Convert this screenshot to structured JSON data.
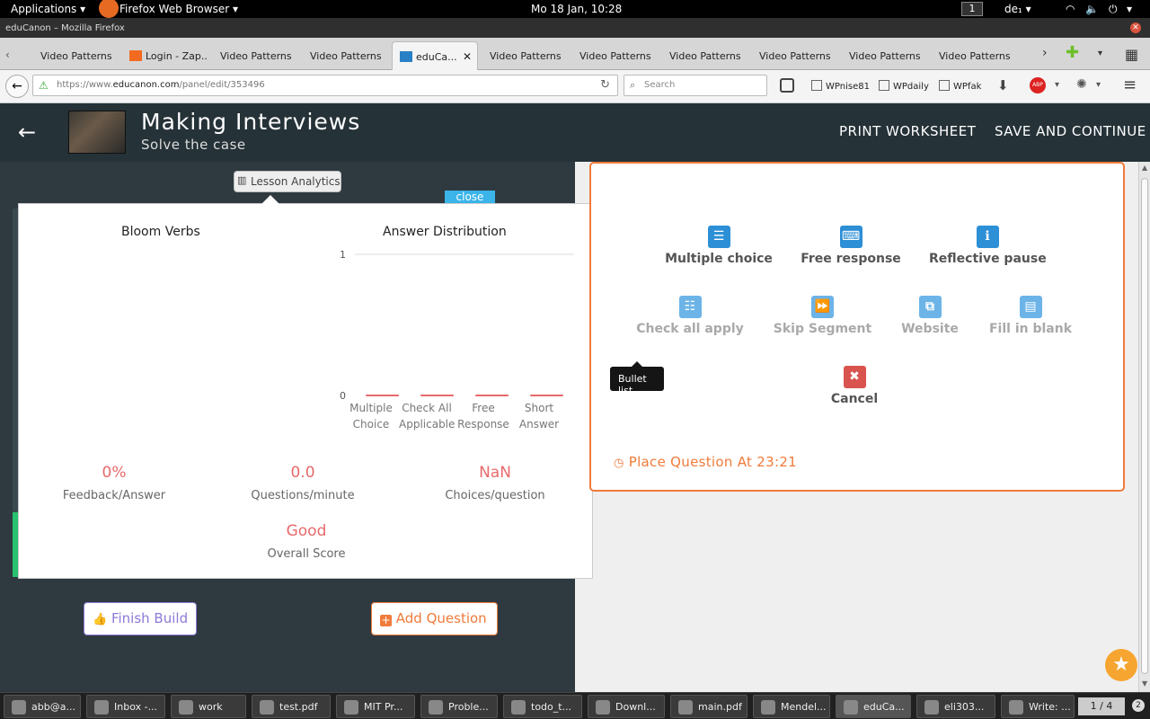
{
  "system_bar": {
    "applications": "Applications",
    "browser_menu": "Firefox Web Browser",
    "clock": "Mo 18 Jan, 10:28",
    "workspace": "1",
    "keyboard": "de₁"
  },
  "window": {
    "title": "eduCanon – Mozilla Firefox"
  },
  "tabs": [
    {
      "label": "Video Patterns"
    },
    {
      "label": "Login - Zap..."
    },
    {
      "label": "Video Patterns"
    },
    {
      "label": "Video Patterns"
    },
    {
      "label": "eduCa..."
    },
    {
      "label": "Video Patterns"
    },
    {
      "label": "Video Patterns"
    },
    {
      "label": "Video Patterns"
    },
    {
      "label": "Video Patterns"
    },
    {
      "label": "Video Patterns"
    },
    {
      "label": "Video Patterns"
    }
  ],
  "navbar": {
    "url_prefix": "https://www.",
    "url_domain": "educanon.com",
    "url_path": "/panel/edit/353496",
    "search_placeholder": "Search",
    "bookmarks": [
      "WPnise81",
      "WPdaily",
      "WPfak"
    ]
  },
  "header": {
    "title": "Making Interviews",
    "subtitle": "Solve the case",
    "print_label": "PRINT WORKSHEET",
    "save_label": "SAVE AND CONTINUE"
  },
  "analytics": {
    "pill_label": "Lesson Analytics",
    "close_label": "close",
    "bloom_title": "Bloom Verbs",
    "dist_title": "Answer Distribution",
    "metrics": [
      {
        "value": "0%",
        "label": "Feedback/Answer"
      },
      {
        "value": "0.0",
        "label": "Questions/minute"
      },
      {
        "value": "NaN",
        "label": "Choices/question"
      },
      {
        "value": "Good",
        "label": "Overall Score"
      }
    ]
  },
  "chart_data": {
    "type": "bar",
    "title": "Answer Distribution",
    "categories": [
      "Multiple Choice",
      "Check All Applicable",
      "Free Response",
      "Short Answer"
    ],
    "category_lines": [
      [
        "Multiple",
        "Choice"
      ],
      [
        "Check All",
        "Applicable"
      ],
      [
        "Free",
        "Response"
      ],
      [
        "Short",
        "Answer"
      ]
    ],
    "values": [
      0,
      0,
      0,
      0
    ],
    "ylim": [
      0,
      1
    ],
    "yticks": [
      "0",
      "1"
    ],
    "bar_color": "#e8696b"
  },
  "builder": {
    "finish_label": "Finish Build",
    "add_label": "Add Question"
  },
  "question_types": [
    {
      "label": "Multiple choice",
      "icon": "list-icon",
      "glyph": "☰",
      "color": "#2d8fd6",
      "enabled": true
    },
    {
      "label": "Free response",
      "icon": "keyboard-icon",
      "glyph": "⌨",
      "color": "#2d8fd6",
      "enabled": true
    },
    {
      "label": "Reflective pause",
      "icon": "info-icon",
      "glyph": "ℹ",
      "color": "#2d8fd6",
      "enabled": true
    },
    {
      "label": "Check all apply",
      "icon": "bullet-list-icon",
      "glyph": "☷",
      "color": "#6cb4e8",
      "enabled": false
    },
    {
      "label": "Skip Segment",
      "icon": "fast-forward-icon",
      "glyph": "⏩",
      "color": "#6cb4e8",
      "enabled": false
    },
    {
      "label": "Website",
      "icon": "external-link-icon",
      "glyph": "⧉",
      "color": "#6cb4e8",
      "enabled": false
    },
    {
      "label": "Fill in blank",
      "icon": "form-icon",
      "glyph": "▤",
      "color": "#6cb4e8",
      "enabled": false
    },
    {
      "label": "Cancel",
      "icon": "close-icon",
      "glyph": "✖",
      "color": "#d9534f",
      "enabled": true
    }
  ],
  "tooltip": "Bullet list",
  "place_question": "Place Question At 23:21",
  "taskbar": {
    "items": [
      {
        "label": "abb@a..."
      },
      {
        "label": "Inbox -..."
      },
      {
        "label": "work"
      },
      {
        "label": "test.pdf"
      },
      {
        "label": "MIT Pr..."
      },
      {
        "label": "Proble..."
      },
      {
        "label": "todo_t..."
      },
      {
        "label": "Downl..."
      },
      {
        "label": "main.pdf"
      },
      {
        "label": "Mendel..."
      },
      {
        "label": "eduCa..."
      },
      {
        "label": "eli303..."
      },
      {
        "label": "Write: ..."
      }
    ],
    "pager": "1 / 4"
  }
}
